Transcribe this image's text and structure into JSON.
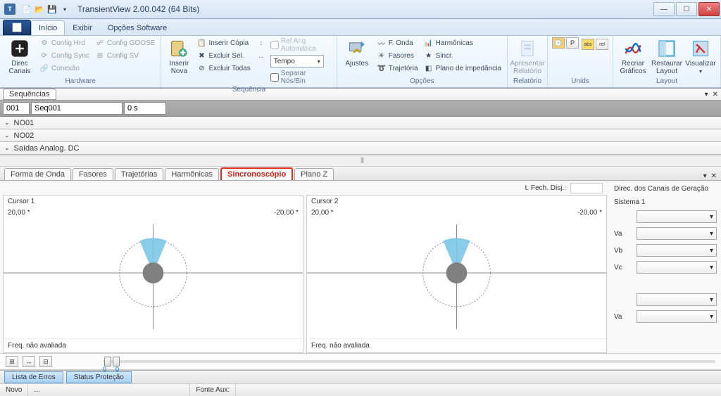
{
  "title": "TransientView 2.00.042 (64 Bits)",
  "ribbon_tabs": {
    "inicio": "Início",
    "exibir": "Exibir",
    "opcoes": "Opções Software"
  },
  "ribbon": {
    "hardware": {
      "direc_canais": "Direc Canais",
      "config_hrd": "Config Hrd",
      "config_goose": "Config GOOSE",
      "config_sync": "Config Sync",
      "config_sv": "Config SV",
      "conexao": "Conexão",
      "label": "Hardware"
    },
    "sequencia": {
      "inserir_nova": "Inserir Nova",
      "inserir_copia": "Inserir Cópia",
      "excluir_sel": "Excluir Sel.",
      "excluir_todas": "Excluir Todas",
      "ref_ang": "Ref Ang Automática",
      "tempo": "Tempo",
      "separar": "Separar Nós/Bin",
      "label": "Sequência"
    },
    "opcoes": {
      "ajustes": "Ajustes",
      "f_onda": "F. Onda",
      "harmonicas": "Harmônicas",
      "fasores": "Fasores",
      "sincr": "Sincr.",
      "trajetoria": "Trajetória",
      "plano_imp": "Plano de impedância",
      "label": "Opções"
    },
    "relatorio": {
      "btn": "Apresentar Relatório",
      "label": "Relatório"
    },
    "unids": {
      "label": "Unids"
    },
    "layout": {
      "recriar": "Recriar Gráficos",
      "restaurar": "Restaurar Layout",
      "visualizar": "Visualizar",
      "label": "Layout"
    }
  },
  "sequencias": {
    "tab": "Sequências",
    "idx": "001",
    "name": "Seq001",
    "time": "0 s",
    "rows": [
      "NO01",
      "NO02",
      "Saídas Analog. DC"
    ]
  },
  "view_tabs": {
    "forma_onda": "Forma de Onda",
    "fasores": "Fasores",
    "trajetorias": "Trajetórias",
    "harmonicas": "Harmônicas",
    "sincronoscopio": "Sincronoscópio",
    "plano_z": "Plano Z"
  },
  "sync": {
    "t_fech": "t. Fech. Disj.:",
    "direc_title": "Direc. dos Canais de Geração",
    "cursor1": {
      "title": "Cursor 1",
      "left": "20,00 *",
      "right": "-20,00 *",
      "freq": "Freq. não avaliada"
    },
    "cursor2": {
      "title": "Cursor 2",
      "left": "20,00 *",
      "right": "-20,00 *",
      "freq": "Freq. não avaliada"
    },
    "sistema1": "Sistema 1",
    "va": "Va",
    "vb": "Vb",
    "vc": "Vc"
  },
  "slider": {
    "v0a": "0",
    "v0b": "0"
  },
  "bottom_tabs": {
    "erros": "Lista de Erros",
    "status": "Status Proteção"
  },
  "status": {
    "novo": "Novo",
    "dots": "...",
    "fonte": "Fonte Aux:"
  }
}
